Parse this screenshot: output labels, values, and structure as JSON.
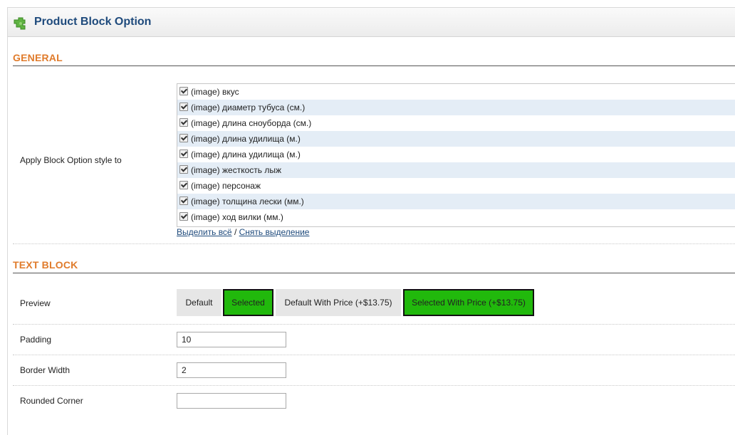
{
  "panel": {
    "title": "Product Block Option",
    "icon": "puzzle-piece-icon"
  },
  "general": {
    "section_title": "GENERAL",
    "apply_label": "Apply Block Option style to",
    "options": [
      {
        "label": "(image) вкус",
        "checked": true
      },
      {
        "label": "(image) диаметр тубуса (см.)",
        "checked": true
      },
      {
        "label": "(image) длина сноуборда (см.)",
        "checked": true
      },
      {
        "label": "(image) длина удилища (м.)",
        "checked": true
      },
      {
        "label": "(image) длина удилища (м.)",
        "checked": true
      },
      {
        "label": "(image) жесткость лыж",
        "checked": true
      },
      {
        "label": "(image) персонаж",
        "checked": true
      },
      {
        "label": "(image) толщина лески (мм.)",
        "checked": true
      },
      {
        "label": "(image) ход вилки (мм.)",
        "checked": true
      }
    ],
    "select_all": "Выделить всё",
    "separator": "/",
    "deselect_all": "Снять выделение"
  },
  "text_block": {
    "section_title": "TEXT BLOCK",
    "preview_label": "Preview",
    "preview_buttons": [
      {
        "label": "Default"
      },
      {
        "label": "Selected"
      },
      {
        "label": "Default With Price (+$13.75)"
      },
      {
        "label": "Selected With Price (+$13.75)"
      }
    ],
    "padding_label": "Padding",
    "padding_value": "10",
    "border_width_label": "Border Width",
    "border_width_value": "2",
    "rounded_corner_label": "Rounded Corner",
    "rounded_corner_value": ""
  },
  "colors": {
    "section_title": "#e07b2b",
    "panel_title": "#1e4a7c",
    "selected_green": "#21b90c",
    "row_alt": "#e4edf6"
  }
}
